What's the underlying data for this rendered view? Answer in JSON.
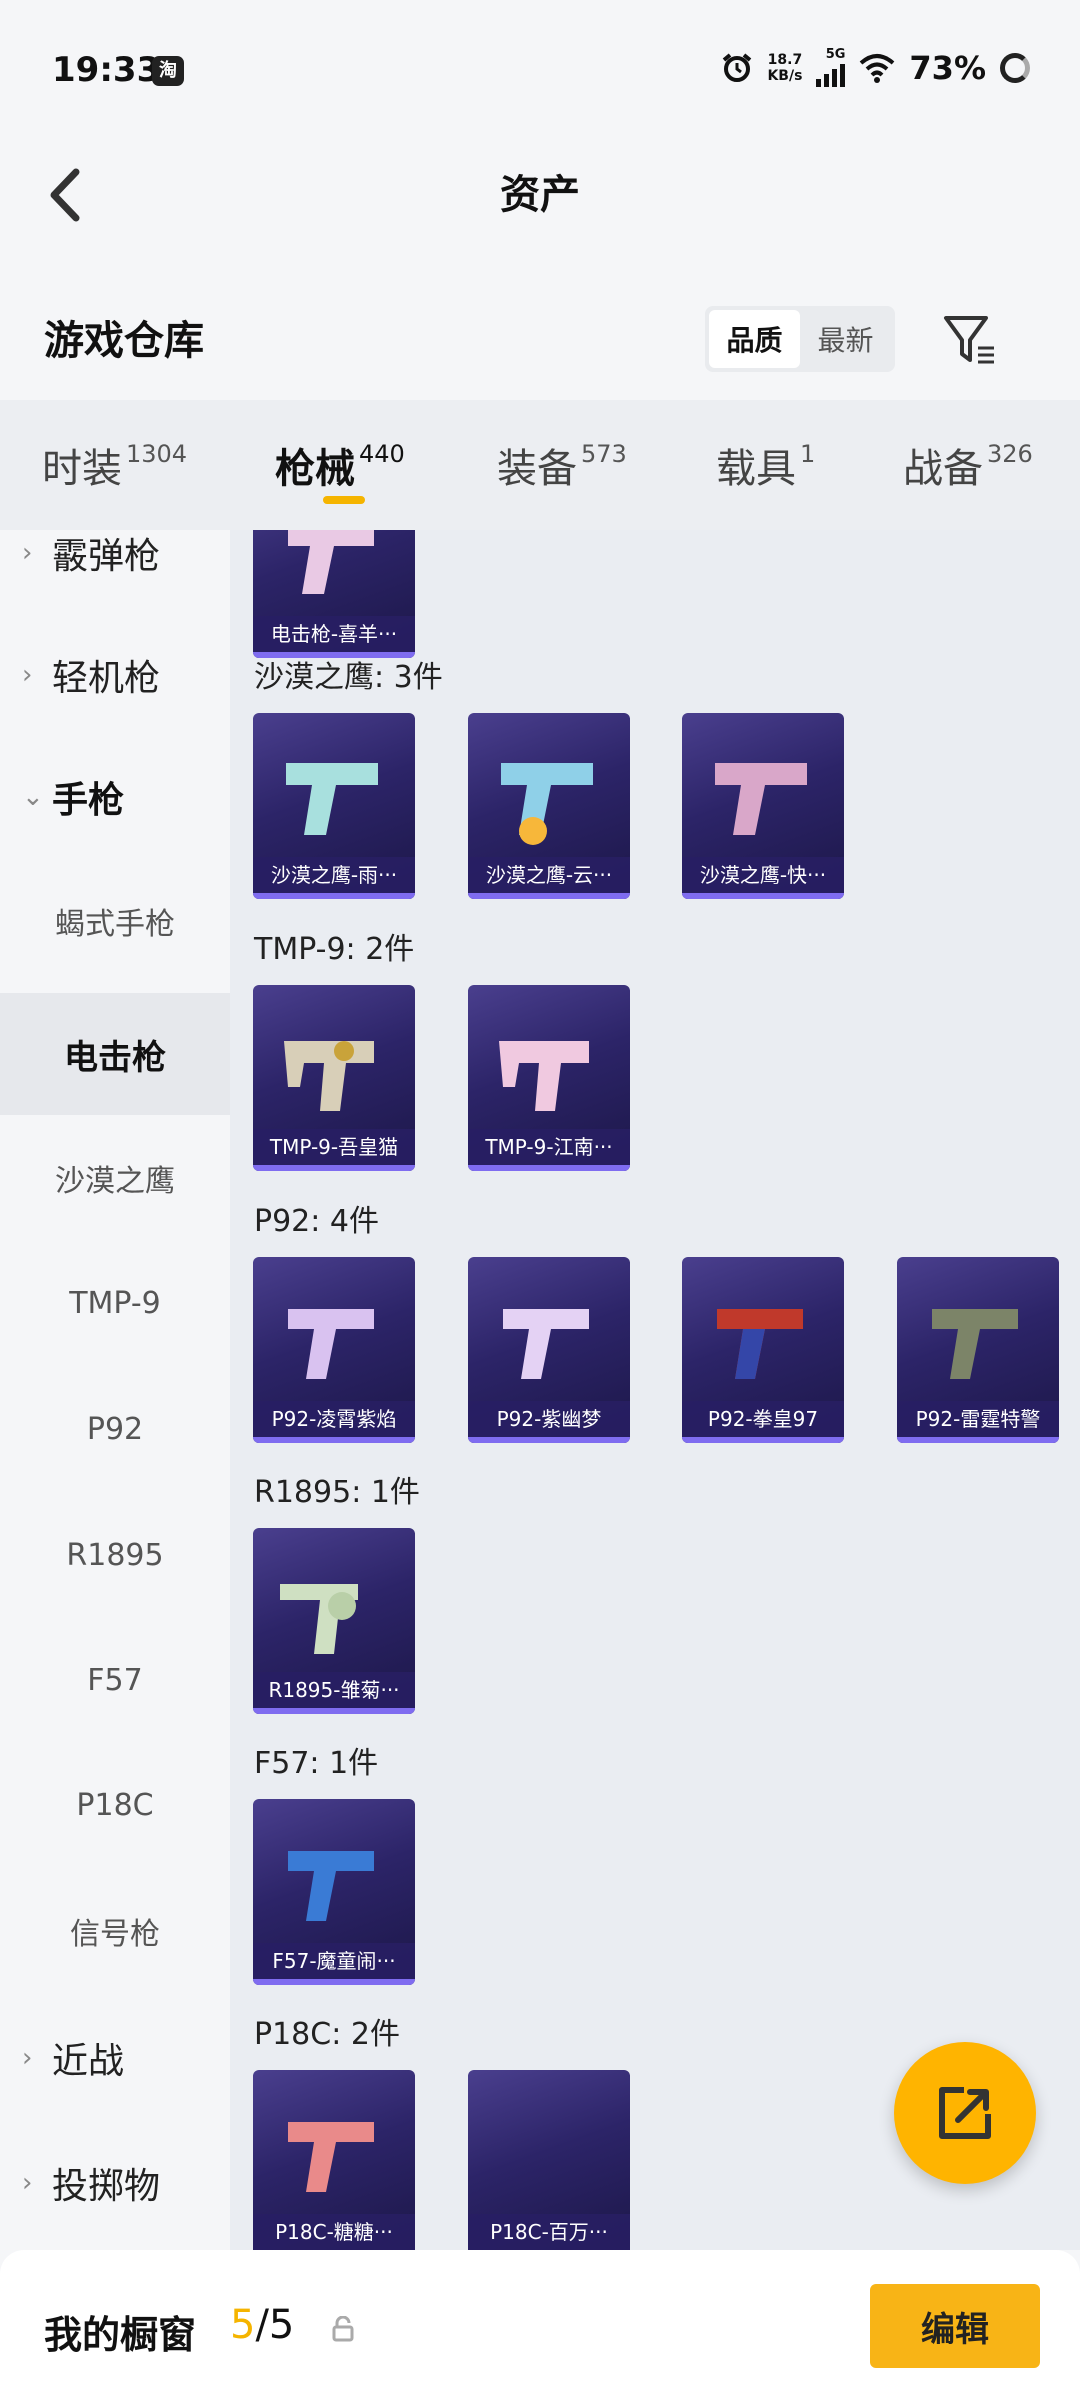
{
  "status": {
    "time": "19:33",
    "app_badge": "淘",
    "net_speed_top": "18.7",
    "net_speed_bottom": "KB/s",
    "net_type": "5G",
    "battery": "73%"
  },
  "header": {
    "title": "资产"
  },
  "warehouse": {
    "title": "游戏仓库",
    "sort": [
      "品质",
      "最新"
    ]
  },
  "tabs": [
    {
      "label": "时装",
      "count": "1304"
    },
    {
      "label": "枪械",
      "count": "440"
    },
    {
      "label": "装备",
      "count": "573"
    },
    {
      "label": "载具",
      "count": "1"
    },
    {
      "label": "战备",
      "count": "326"
    }
  ],
  "sidebar": [
    "霰弹枪",
    "轻机枪",
    "手枪",
    "蝎式手枪",
    "电击枪",
    "沙漠之鹰",
    "TMP-9",
    "P92",
    "R1895",
    "F57",
    "P18C",
    "信号枪",
    "近战",
    "投掷物"
  ],
  "content": {
    "top_card": "电击枪-喜羊···",
    "sections": [
      {
        "title": "沙漠之鹰: 3件",
        "items": [
          "沙漠之鹰-雨···",
          "沙漠之鹰-云···",
          "沙漠之鹰-快···"
        ]
      },
      {
        "title": "TMP-9: 2件",
        "items": [
          "TMP-9-吾皇猫",
          "TMP-9-江南···"
        ]
      },
      {
        "title": "P92: 4件",
        "items": [
          "P92-凌霄紫焰",
          "P92-紫幽梦",
          "P92-拳皇97",
          "P92-雷霆特警"
        ]
      },
      {
        "title": "R1895: 1件",
        "items": [
          "R1895-雏菊···"
        ]
      },
      {
        "title": "F57: 1件",
        "items": [
          "F57-魔童闹···"
        ]
      },
      {
        "title": "P18C: 2件",
        "items": [
          "P18C-糖糖···",
          "P18C-百万···"
        ]
      }
    ]
  },
  "bottom": {
    "label": "我的橱窗",
    "used": "5",
    "sep_total": "/5",
    "edit": "编辑"
  },
  "colors": {
    "accent": "#f5b400",
    "card_bg": "#2c2468"
  }
}
